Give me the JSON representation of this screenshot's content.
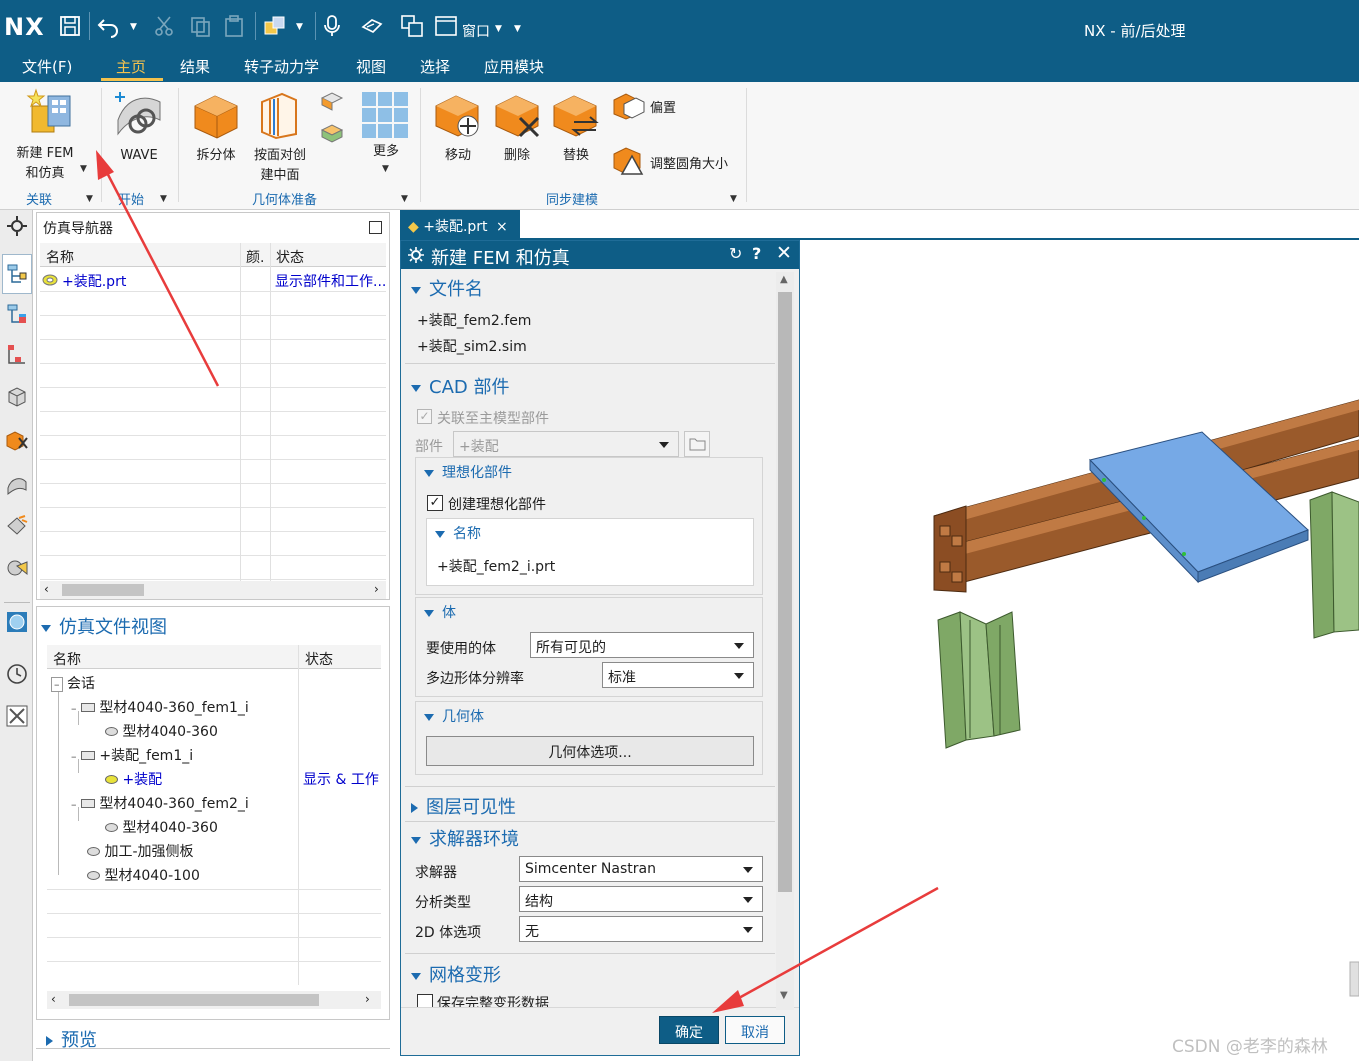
{
  "titlebar": {
    "logo": "NX",
    "title": "NX - 前/后处理",
    "window_menu": "窗口"
  },
  "menu": {
    "items": [
      "文件(F)",
      "主页",
      "结果",
      "转子动力学",
      "视图",
      "选择",
      "应用模块"
    ],
    "active": "主页"
  },
  "ribbon": {
    "new_fem_line1": "新建 FEM",
    "new_fem_line2": "和仿真",
    "wave": "WAVE",
    "split_body": "拆分体",
    "face_line1": "按面对创",
    "face_line2": "建中面",
    "more": "更多",
    "move": "移动",
    "delete": "删除",
    "replace": "替换",
    "offset": "偏置",
    "resize_blend": "调整圆角大小",
    "groups": {
      "assoc": "关联",
      "start": "开始",
      "geometry_prep": "几何体准备",
      "sync_modeling": "同步建模"
    }
  },
  "navigator": {
    "title": "仿真导航器",
    "columns": [
      "名称",
      "颜.",
      "状态"
    ],
    "rows": [
      {
        "name": "+装配.prt",
        "status": "显示部件和工作..."
      }
    ]
  },
  "sim_file_view": {
    "title": "仿真文件视图",
    "columns": [
      "名称",
      "状态"
    ],
    "tree": [
      {
        "label": "会话",
        "status": ""
      },
      {
        "label": "型材4040-360_fem1_i",
        "status": ""
      },
      {
        "label": "型材4040-360",
        "status": ""
      },
      {
        "label": "+装配_fem1_i",
        "status": ""
      },
      {
        "label": "+装配",
        "status": "显示 & 工作"
      },
      {
        "label": "型材4040-360_fem2_i",
        "status": ""
      },
      {
        "label": "型材4040-360",
        "status": ""
      },
      {
        "label": "加工-加强侧板",
        "status": ""
      },
      {
        "label": "型材4040-100",
        "status": ""
      }
    ],
    "preview": "预览"
  },
  "view_tab": "+装配.prt",
  "dialog": {
    "title": "新建 FEM 和仿真",
    "file_section": "文件名",
    "fem_file": "+装配_fem2.fem",
    "sim_file": "+装配_sim2.sim",
    "cad_section": "CAD 部件",
    "assoc_master": "关联至主模型部件",
    "part_label": "部件",
    "part_value": "+装配",
    "idealized_section": "理想化部件",
    "create_idealized": "创建理想化部件",
    "name_section": "名称",
    "idealized_name": "+装配_fem2_i.prt",
    "body_section": "体",
    "bodies_label": "要使用的体",
    "bodies_value": "所有可见的",
    "poly_label": "多边形体分辨率",
    "poly_value": "标准",
    "geometry_section": "几何体",
    "geometry_button": "几何体选项...",
    "layer_section": "图层可见性",
    "solver_section": "求解器环境",
    "solver_label": "求解器",
    "solver_value": "Simcenter Nastran",
    "analysis_label": "分析类型",
    "analysis_value": "结构",
    "twod_label": "2D 体选项",
    "twod_value": "无",
    "mesh_section": "网格变形",
    "save_deform": "保存完整变形数据",
    "ok": "确定",
    "cancel": "取消"
  },
  "watermark": "CSDN @老李的森林",
  "colors": {
    "nx_blue": "#0e5d86",
    "accent_blue": "#1c6bb0",
    "arrow_red": "#e83c3c",
    "plate_blue": "#76a9e6",
    "beam_brown": "#9a5a2b",
    "leg_green": "#7fa866"
  }
}
